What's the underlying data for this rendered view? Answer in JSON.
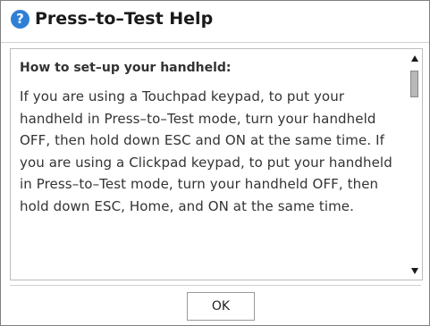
{
  "dialog": {
    "title": "Press–to–Test Help",
    "title_icon": "help-icon",
    "title_icon_glyph": "?",
    "accent_color": "#2f7fd6"
  },
  "content": {
    "heading": "How to set–up your handheld:",
    "body": "If you are using a Touchpad keypad, to put your handheld in Press–to–Test mode, turn your handheld OFF, then hold down ESC and ON at the same time. If you are using a Clickpad keypad, to put your handheld in Press–to–Test mode, turn your handheld OFF, then hold down ESC, Home, and ON at the same time."
  },
  "scrollbar": {
    "up_icon": "scroll-up-arrow-icon",
    "down_icon": "scroll-down-arrow-icon"
  },
  "footer": {
    "ok_label": "OK"
  }
}
